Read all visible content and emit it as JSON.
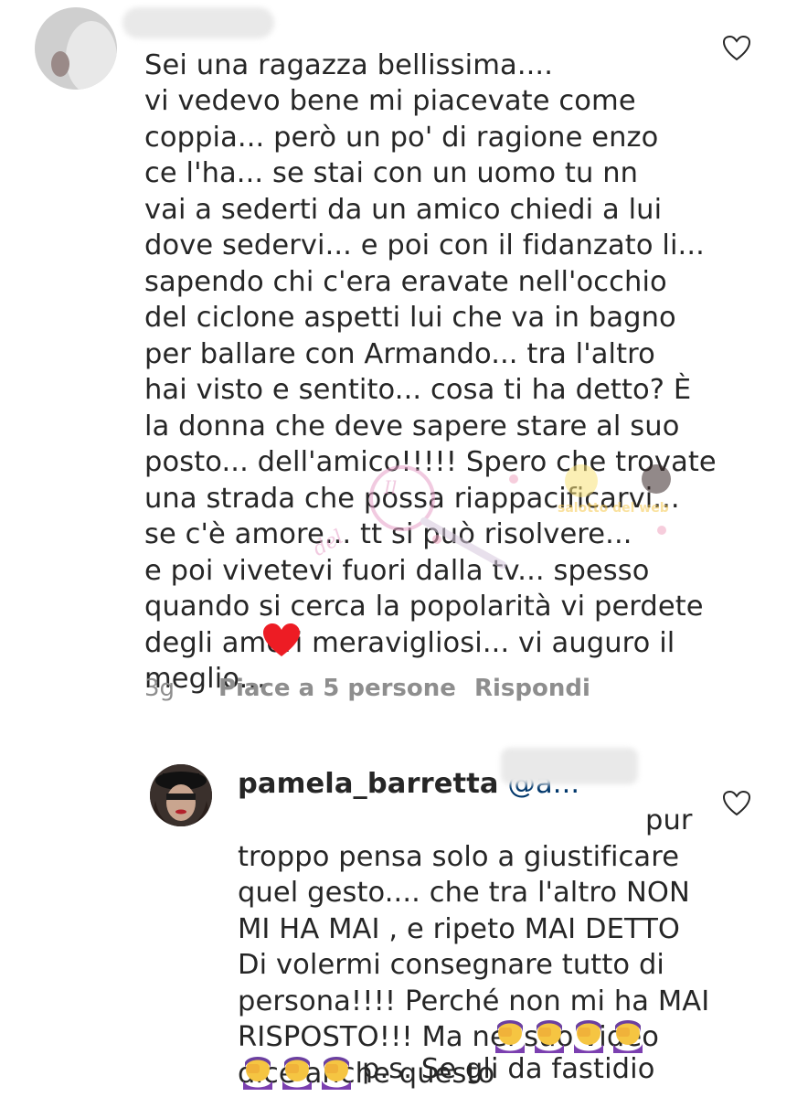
{
  "comment1": {
    "username": "d...acty",
    "text": "Sei una ragazza bellissima....\nvi vedevo bene mi piacevate come\ncoppia... però un po' di ragione enzo\nce l'ha... se stai con un uomo tu nn\nvai a sederti da un amico chiedi a lui\ndove sedervi... e poi con il fidanzato li...\nsapendo chi c'era eravate nell'occhio\ndel ciclone aspetti lui che va in bagno\nper ballare con Armando... tra l'altro\nhai visto e sentito... cosa ti ha detto? È\nla donna che deve sapere stare al suo\nposto... dell'amico!!!!! Spero che trovate\nuna strada che possa riappacificarvi...\nse c'è amore... tt si può risolvere...\ne poi vivetevi fuori dalla tv... spesso\nquando si cerca la popolarità vi perdete\ndegli amori meravigliosi... vi auguro il\nmeglio...",
    "time": "3g",
    "likes": "Piace a 5 persone",
    "reply": "Rispondi",
    "heart_color": "#ed1c24"
  },
  "comment2": {
    "username": "pamela_barretta",
    "mention": "@a...",
    "line1_end": "pur",
    "text": "troppo pensa solo a giustificare\nquel gesto.... che tra l'altro NON\nMI HA MAI , e ripeto MAI DETTO\nDi volermi consegnare tutto di\npersona!!!! Perché non mi ha MAI\nRISPOSTO!!! Ma nel suo video\ndice anche questo",
    "line_last": "p.s. Se gli da fastidio"
  },
  "watermark": {
    "text": "Il salotto del web"
  },
  "colors": {
    "text": "#262626",
    "meta": "#8e8e8e",
    "mention": "#00376b",
    "heart": "#ed1c24"
  }
}
